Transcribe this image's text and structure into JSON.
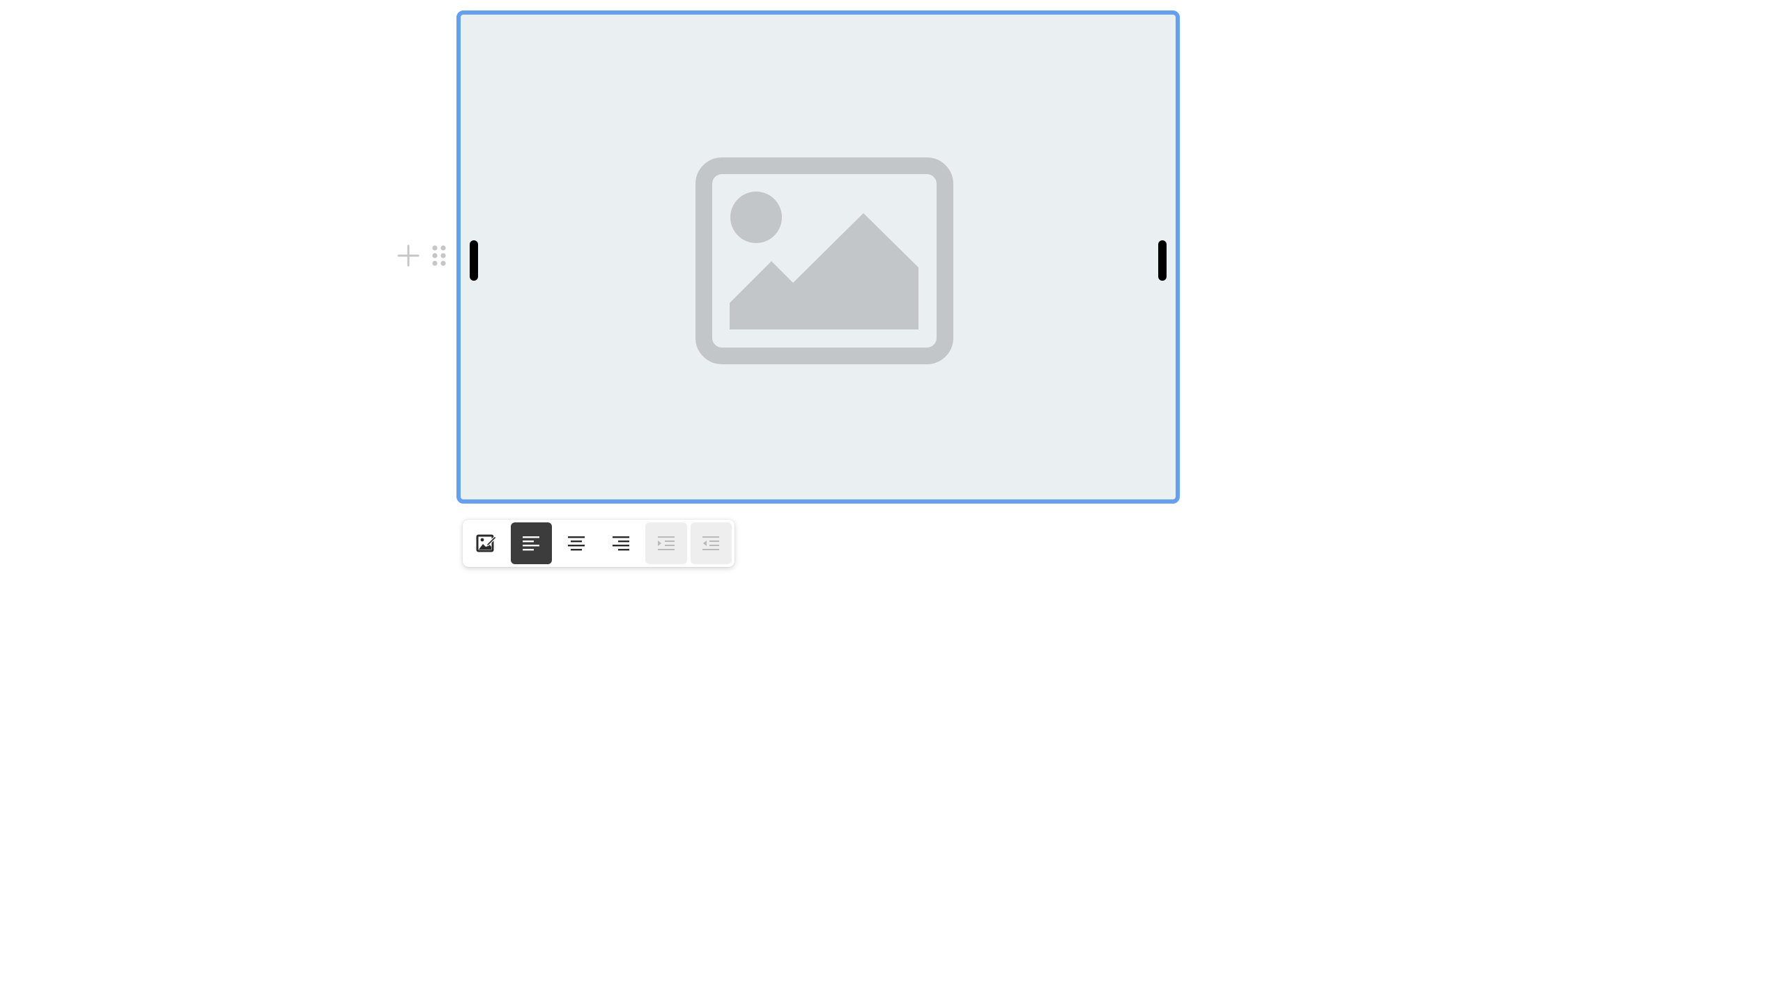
{
  "colors": {
    "selection_border": "#64a0ee",
    "placeholder_bg": "#eaeff2",
    "placeholder_icon": "#c2c6c9",
    "active_button_bg": "#3c3c3c",
    "disabled_button_bg": "#eeeeee",
    "control_icon": "#c6c6c6"
  },
  "block_controls": {
    "add": {
      "icon": "plus-icon"
    },
    "drag": {
      "icon": "drag-handle-icon"
    }
  },
  "image_block": {
    "state": "selected",
    "placeholder_icon": "image-placeholder-icon",
    "handles": [
      "resize-left",
      "resize-right"
    ]
  },
  "toolbar": {
    "buttons": [
      {
        "id": "replace-image",
        "icon": "image-edit-icon",
        "state": "normal"
      },
      {
        "id": "align-left",
        "icon": "align-left-icon",
        "state": "active"
      },
      {
        "id": "align-center",
        "icon": "align-center-icon",
        "state": "normal"
      },
      {
        "id": "align-right",
        "icon": "align-right-icon",
        "state": "normal"
      },
      {
        "id": "indent",
        "icon": "indent-icon",
        "state": "disabled"
      },
      {
        "id": "outdent",
        "icon": "outdent-icon",
        "state": "disabled"
      }
    ]
  }
}
